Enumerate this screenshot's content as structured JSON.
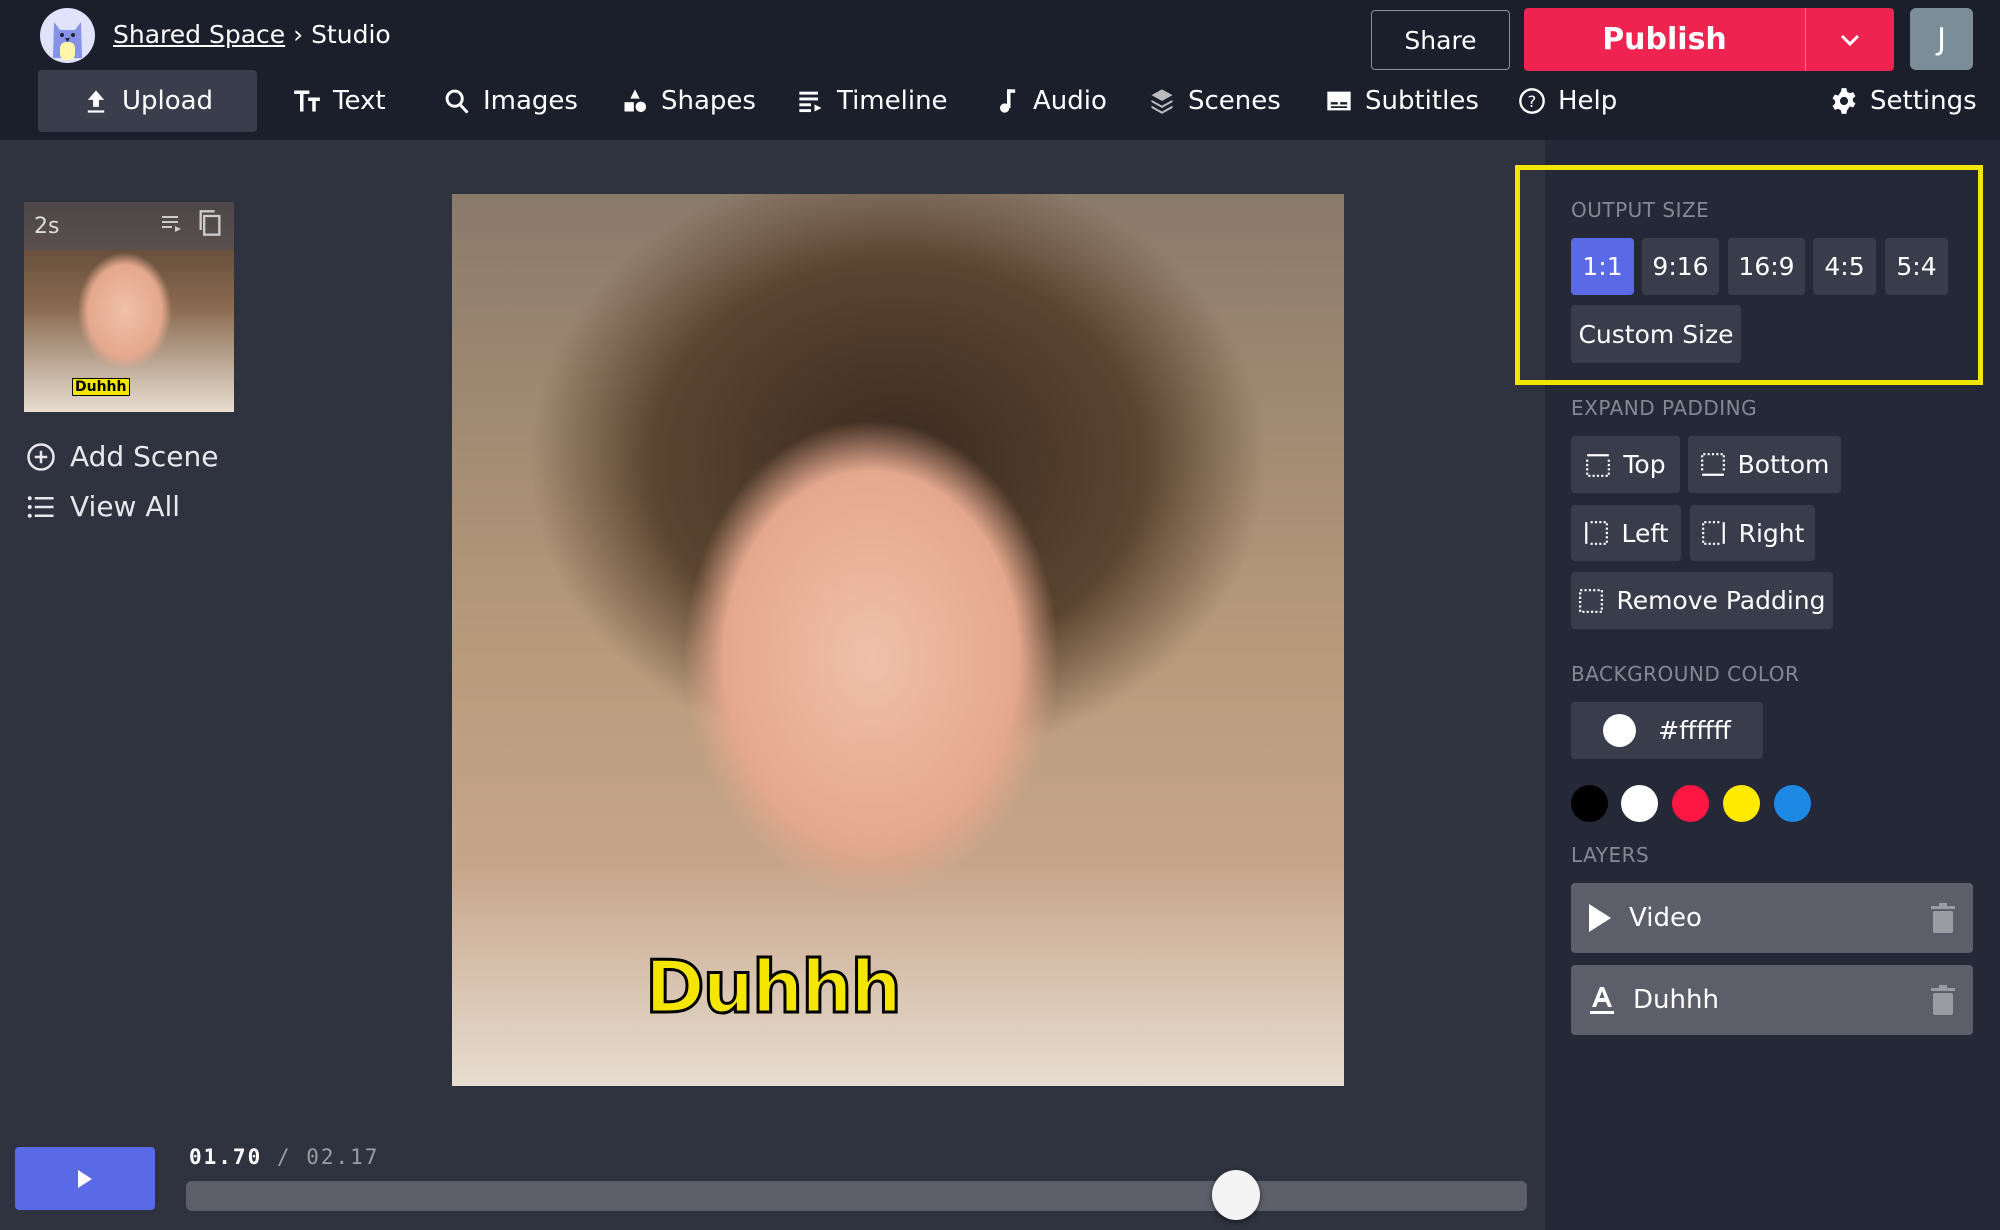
{
  "header": {
    "breadcrumb_link": "Shared Space",
    "breadcrumb_sep": "›",
    "breadcrumb_current": "Studio",
    "share": "Share",
    "publish": "Publish",
    "avatar_initial": "J"
  },
  "toolbar": [
    "Upload",
    "Text",
    "Images",
    "Shapes",
    "Timeline",
    "Audio",
    "Scenes",
    "Subtitles",
    "Help",
    "Settings"
  ],
  "scenes": {
    "duration": "2s",
    "thumb_caption": "Duhhh",
    "add_scene": "Add Scene",
    "view_all": "View All"
  },
  "canvas": {
    "caption": "Duhhh"
  },
  "player": {
    "current": "01.70",
    "sep": "/",
    "total": "02.17",
    "progress": 0.783
  },
  "panel": {
    "output_size_label": "OUTPUT SIZE",
    "sizes": [
      "1:1",
      "9:16",
      "16:9",
      "4:5",
      "5:4"
    ],
    "selected_size": "1:1",
    "custom_size": "Custom Size",
    "expand_padding_label": "EXPAND PADDING",
    "padding": [
      "Top",
      "Bottom",
      "Left",
      "Right"
    ],
    "remove_padding": "Remove Padding",
    "background_color_label": "BACKGROUND COLOR",
    "background_color": "#ffffff",
    "swatches": [
      "#000000",
      "#ffffff",
      "#ff1744",
      "#ffea00",
      "#1e88e5"
    ],
    "layers_label": "LAYERS",
    "layers": [
      "Video",
      "Duhhh"
    ]
  },
  "colors": {
    "accent": "#5a6ae6",
    "publish": "#ef2350",
    "highlight": "#f0e600"
  }
}
